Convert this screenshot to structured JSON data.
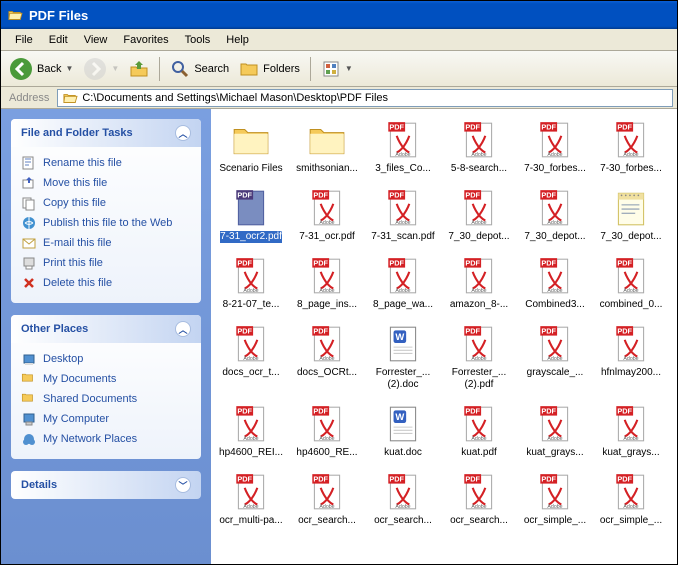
{
  "window": {
    "title": "PDF Files"
  },
  "menus": {
    "file": "File",
    "edit": "Edit",
    "view": "View",
    "favorites": "Favorites",
    "tools": "Tools",
    "help": "Help"
  },
  "toolbar": {
    "back": "Back",
    "search": "Search",
    "folders": "Folders"
  },
  "address": {
    "label": "Address",
    "path": "C:\\Documents and Settings\\Michael Mason\\Desktop\\PDF Files"
  },
  "panels": {
    "tasks": {
      "title": "File and Folder Tasks",
      "items": [
        "Rename this file",
        "Move this file",
        "Copy this file",
        "Publish this file to the Web",
        "E-mail this file",
        "Print this file",
        "Delete this file"
      ]
    },
    "places": {
      "title": "Other Places",
      "items": [
        "Desktop",
        "My Documents",
        "Shared Documents",
        "My Computer",
        "My Network Places"
      ]
    },
    "details": {
      "title": "Details"
    }
  },
  "files": [
    {
      "name": "Scenario Files",
      "type": "folder"
    },
    {
      "name": "smithsonian...",
      "type": "folder"
    },
    {
      "name": "3_files_Co...",
      "type": "pdf"
    },
    {
      "name": "5-8-search...",
      "type": "pdf"
    },
    {
      "name": "7-30_forbes...",
      "type": "pdf"
    },
    {
      "name": "7-30_forbes...",
      "type": "pdf"
    },
    {
      "name": "7-31_ocr2.pdf",
      "type": "pdf",
      "selected": true
    },
    {
      "name": "7-31_ocr.pdf",
      "type": "pdf"
    },
    {
      "name": "7-31_scan.pdf",
      "type": "pdf"
    },
    {
      "name": "7_30_depot...",
      "type": "pdf"
    },
    {
      "name": "7_30_depot...",
      "type": "pdf"
    },
    {
      "name": "7_30_depot...",
      "type": "txt"
    },
    {
      "name": "8-21-07_te...",
      "type": "pdf"
    },
    {
      "name": "8_page_ins...",
      "type": "pdf"
    },
    {
      "name": "8_page_wa...",
      "type": "pdf"
    },
    {
      "name": "amazon_8-...",
      "type": "pdf"
    },
    {
      "name": "Combined3...",
      "type": "pdf"
    },
    {
      "name": "combined_0...",
      "type": "pdf"
    },
    {
      "name": "docs_ocr_t...",
      "type": "pdf"
    },
    {
      "name": "docs_OCRt...",
      "type": "pdf"
    },
    {
      "name": "Forrester_...",
      "name2": "(2).doc",
      "type": "doc"
    },
    {
      "name": "Forrester_...",
      "name2": "(2).pdf",
      "type": "pdf"
    },
    {
      "name": "grayscale_...",
      "type": "pdf"
    },
    {
      "name": "hfnlmay200...",
      "type": "pdf"
    },
    {
      "name": "hp4600_REI...",
      "type": "pdf"
    },
    {
      "name": "hp4600_RE...",
      "type": "pdf"
    },
    {
      "name": "kuat.doc",
      "type": "doc"
    },
    {
      "name": "kuat.pdf",
      "type": "pdf"
    },
    {
      "name": "kuat_grays...",
      "type": "pdf"
    },
    {
      "name": "kuat_grays...",
      "type": "pdf"
    },
    {
      "name": "ocr_multi-pa...",
      "type": "pdf"
    },
    {
      "name": "ocr_search...",
      "type": "pdf"
    },
    {
      "name": "ocr_search...",
      "type": "pdf"
    },
    {
      "name": "ocr_search...",
      "type": "pdf"
    },
    {
      "name": "ocr_simple_...",
      "type": "pdf"
    },
    {
      "name": "ocr_simple_...",
      "type": "pdf"
    }
  ]
}
